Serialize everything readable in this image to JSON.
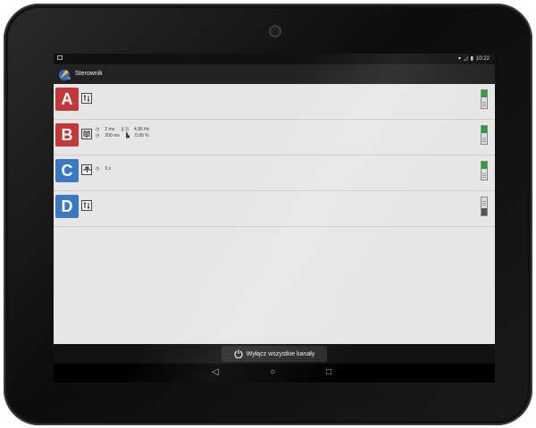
{
  "status_bar": {
    "time": "10:22"
  },
  "app_bar": {
    "title": "Sterownik"
  },
  "channels": [
    {
      "letter": "A",
      "color": "#c0393b",
      "mode": "manual",
      "params": [],
      "state": "on"
    },
    {
      "letter": "B",
      "color": "#c0393b",
      "mode": "pwm",
      "params": [
        "2 ms",
        "4,95 Hz",
        "200 ms",
        "0,99 %"
      ],
      "state": "on"
    },
    {
      "letter": "C",
      "color": "#3a78c2",
      "mode": "pulse",
      "params": [
        "3 s"
      ],
      "state": "on"
    },
    {
      "letter": "D",
      "color": "#3a78c2",
      "mode": "manual",
      "params": [],
      "state": "off"
    }
  ],
  "bottom": {
    "off_all_label": "Wyłącz wszystkie kanały"
  },
  "nav": {
    "back_icon": "back-triangle",
    "home_icon": "home-circle",
    "recents_icon": "recents-square"
  }
}
